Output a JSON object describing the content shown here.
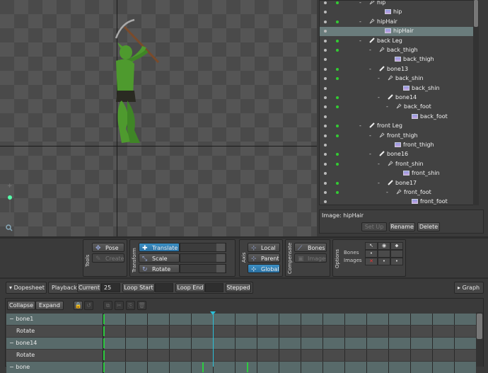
{
  "viewport": {
    "zoom_plus": "+",
    "magnifier": "magnifier-icon"
  },
  "tree": {
    "rows": [
      {
        "label": "hip",
        "type": "bone",
        "dash": "-",
        "key": true
      },
      {
        "label": "hip",
        "type": "image",
        "dash": "",
        "key": false
      },
      {
        "label": "hipHair",
        "type": "bone",
        "dash": "-",
        "key": true
      },
      {
        "label": "hipHair",
        "type": "image",
        "dash": "",
        "key": false,
        "selected": true
      },
      {
        "label": "back Leg",
        "type": "group",
        "dash": "-",
        "key": true
      },
      {
        "label": "back_thigh",
        "type": "bone",
        "dash": "-",
        "key": true
      },
      {
        "label": "back_thigh",
        "type": "image",
        "dash": "",
        "key": false
      },
      {
        "label": "bone13",
        "type": "group",
        "dash": "-",
        "key": true
      },
      {
        "label": "back_shin",
        "type": "bone",
        "dash": "-",
        "key": true
      },
      {
        "label": "back_shin",
        "type": "image",
        "dash": "",
        "key": false
      },
      {
        "label": "bone14",
        "type": "group",
        "dash": "-",
        "key": true
      },
      {
        "label": "back_foot",
        "type": "bone",
        "dash": "-",
        "key": true
      },
      {
        "label": "back_foot",
        "type": "image",
        "dash": "",
        "key": false
      },
      {
        "label": "front Leg",
        "type": "group",
        "dash": "-",
        "key": true
      },
      {
        "label": "front_thigh",
        "type": "bone",
        "dash": "-",
        "key": true
      },
      {
        "label": "front_thigh",
        "type": "image",
        "dash": "",
        "key": false
      },
      {
        "label": "bone16",
        "type": "group",
        "dash": "-",
        "key": true
      },
      {
        "label": "front_shin",
        "type": "bone",
        "dash": "-",
        "key": true
      },
      {
        "label": "front_shin",
        "type": "image",
        "dash": "",
        "key": false
      },
      {
        "label": "bone17",
        "type": "group",
        "dash": "-",
        "key": true
      },
      {
        "label": "front_foot",
        "type": "bone",
        "dash": "-",
        "key": true
      },
      {
        "label": "front_foot",
        "type": "image",
        "dash": "",
        "key": false
      }
    ]
  },
  "image_panel": {
    "label": "Image: hipHair",
    "setup_label": "Set Up",
    "rename_label": "Rename",
    "delete_label": "Delete"
  },
  "tools": {
    "tools_title": "Tools",
    "pose": "Pose",
    "create": "Create",
    "transform_title": "Transform",
    "translate": "Translate",
    "scale": "Scale",
    "rotate": "Rotate",
    "axis_title": "Axis",
    "local": "Local",
    "parent": "Parent",
    "global": "Global",
    "compensate_title": "Compensate",
    "bones": "Bones",
    "images": "Images",
    "options_title": "Options",
    "opt_bones": "Bones",
    "opt_images": "Images"
  },
  "playback": {
    "dopesheet": "Dopesheet",
    "playback": "Playback",
    "current": "Current",
    "current_value": "25",
    "loop_start": "Loop Start",
    "loop_end": "Loop End",
    "stepped": "Stepped",
    "graph": "Graph"
  },
  "dopesheet": {
    "collapse": "Collapse",
    "expand": "Expand",
    "rows": [
      {
        "label": "bone1",
        "kind": "bone",
        "keys": [
          0
        ]
      },
      {
        "label": "Rotate",
        "kind": "attr",
        "keys": [
          0
        ]
      },
      {
        "label": "bone14",
        "kind": "bone",
        "keys": [
          0
        ]
      },
      {
        "label": "Rotate",
        "kind": "attr",
        "keys": [
          0
        ]
      },
      {
        "label": "bone",
        "kind": "bone",
        "keys": [
          0,
          9,
          13
        ]
      }
    ]
  },
  "colors": {
    "accent": "#3b8fc4",
    "keyframe": "#2ecc40",
    "playhead": "#2bc0d8",
    "selection": "#6a7c7c"
  }
}
